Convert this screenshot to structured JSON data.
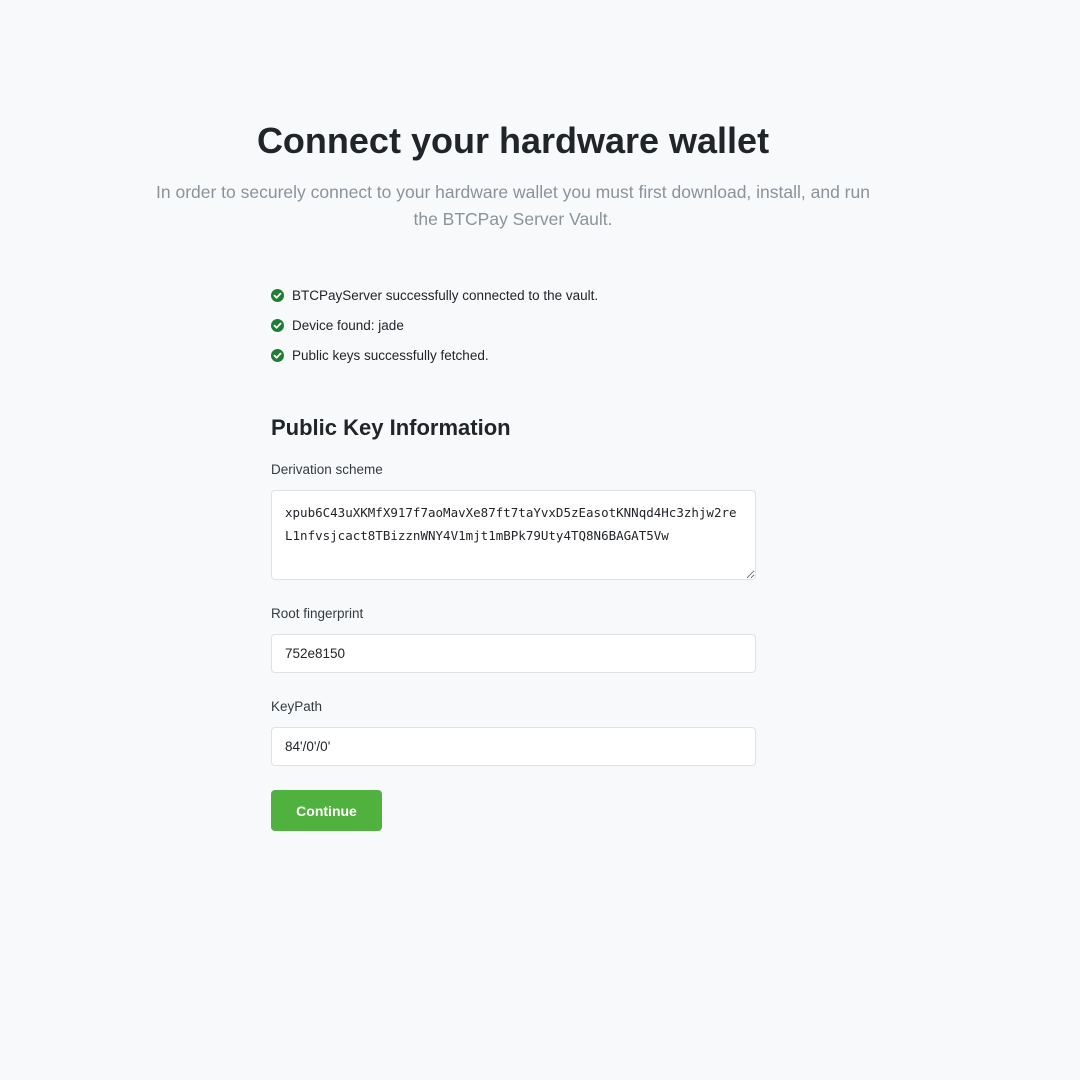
{
  "header": {
    "title": "Connect your hardware wallet",
    "subtitle": "In order to securely connect to your hardware wallet you must first download, install, and run the BTCPay Server Vault."
  },
  "status": {
    "items": [
      {
        "text": "BTCPayServer successfully connected to the vault.",
        "icon": "check-circle-icon"
      },
      {
        "text": "Device found: jade",
        "icon": "check-circle-icon"
      },
      {
        "text": "Public keys successfully fetched.",
        "icon": "check-circle-icon"
      }
    ],
    "icon_color": "#1e7e34"
  },
  "public_key_info": {
    "title": "Public Key Information",
    "derivation_scheme": {
      "label": "Derivation scheme",
      "value": "xpub6C43uXKMfX917f7aoMavXe87ft7taYvxD5zEasotKNNqd4Hc3zhjw2reL1nfvsjcact8TBizznWNY4V1mjt1mBPk79Uty4TQ8N6BAGAT5Vw"
    },
    "root_fingerprint": {
      "label": "Root fingerprint",
      "value": "752e8150"
    },
    "key_path": {
      "label": "KeyPath",
      "value": "84'/0'/0'"
    }
  },
  "actions": {
    "continue_label": "Continue",
    "continue_color": "#51b13e"
  }
}
